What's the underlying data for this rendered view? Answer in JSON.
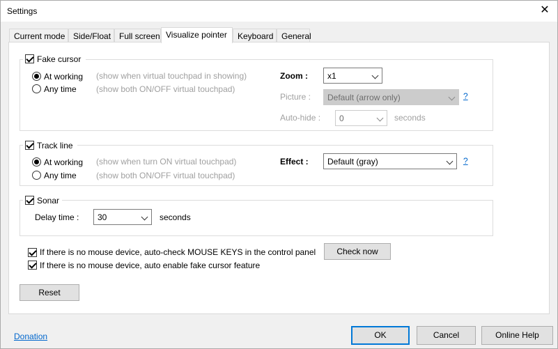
{
  "window": {
    "title": "Settings"
  },
  "tabs": [
    {
      "label": "Current mode"
    },
    {
      "label": "Side/Float"
    },
    {
      "label": "Full screen"
    },
    {
      "label": "Visualize pointer"
    },
    {
      "label": "Keyboard"
    },
    {
      "label": "General"
    }
  ],
  "fake_cursor": {
    "label": "Fake cursor",
    "checked": true,
    "at_working": {
      "label": "At working",
      "hint": "(show when virtual touchpad in showing)",
      "selected": true
    },
    "any_time": {
      "label": "Any time",
      "hint": "(show both ON/OFF virtual touchpad)",
      "selected": false
    },
    "zoom": {
      "label": "Zoom :",
      "value": "x1"
    },
    "picture": {
      "label": "Picture :",
      "value": "Default (arrow only)",
      "help": "?"
    },
    "auto_hide": {
      "label": "Auto-hide :",
      "value": "0",
      "unit": "seconds"
    }
  },
  "track_line": {
    "label": "Track line",
    "checked": true,
    "at_working": {
      "label": "At working",
      "hint": "(show when turn ON virtual touchpad)",
      "selected": true
    },
    "any_time": {
      "label": "Any time",
      "hint": "(show both ON/OFF virtual touchpad)",
      "selected": false
    },
    "effect": {
      "label": "Effect :",
      "value": "Default (gray)",
      "help": "?"
    }
  },
  "sonar": {
    "label": "Sonar",
    "checked": true,
    "delay": {
      "label": "Delay time :",
      "value": "30",
      "unit": "seconds"
    }
  },
  "options": {
    "mouse_keys": {
      "label": "If there is no mouse device, auto-check MOUSE KEYS in the control panel",
      "checked": true
    },
    "fake_cursor_auto": {
      "label": "If there is no mouse device, auto enable fake cursor feature",
      "checked": true
    },
    "check_now": "Check now"
  },
  "reset": "Reset",
  "footer": {
    "donation": "Donation",
    "ok": "OK",
    "cancel": "Cancel",
    "help": "Online Help"
  }
}
